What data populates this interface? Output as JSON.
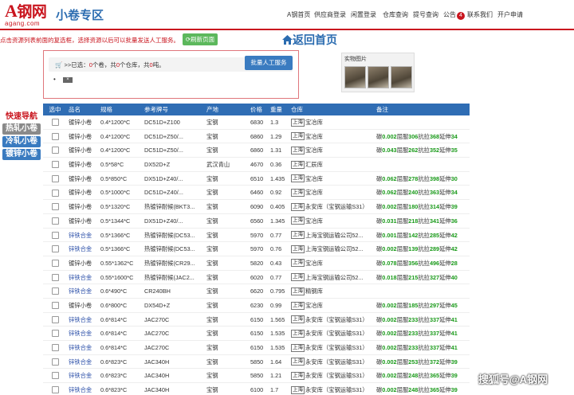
{
  "header": {
    "logo_main": "钢网",
    "logo_a": "A",
    "logo_sub": "agang.com",
    "site_title": "小卷专区",
    "nav": [
      "A钢首页",
      "供应商登录",
      "闲置登录",
      "仓库查询",
      "提号查询",
      "公告",
      "联系我们",
      "开户申请"
    ],
    "notice_count": "4"
  },
  "notice": {
    "text": "点击资源列表前面的复选框，选择资源以后可以批量发送人工服务。",
    "refresh_label": "刷新页面",
    "home_label": "返回首页"
  },
  "selection": {
    "prefix": ">>已选：",
    "rolls": "0",
    "rolls_unit": "个卷，共",
    "warehouses": "0",
    "wh_unit": "个仓库，共",
    "weight": "0",
    "weight_unit": "吨。",
    "batch_label": "批量人工服务",
    "remove_label": "×"
  },
  "photos": {
    "title": "实物图片"
  },
  "side_nav": {
    "title": "快速导航",
    "items": [
      "热轧小卷",
      "冷轧小卷",
      "镀锌小卷"
    ]
  },
  "table": {
    "headers": [
      "选中",
      "品名",
      "规格",
      "参考牌号",
      "产地",
      "价格",
      "重量",
      "仓库",
      "备注"
    ],
    "rows": [
      {
        "name": "镀锌小卷",
        "link": false,
        "spec": "0.4*1200*C",
        "grade": "DC51D+Z100",
        "origin": "宝钢",
        "price": "6830",
        "weight": "1.3",
        "city": "上海",
        "wh": "宝冶库",
        "n1": "",
        "n2": "",
        "n3": ""
      },
      {
        "name": "镀锌小卷",
        "link": false,
        "spec": "0.4*1200*C",
        "grade": "DC51D+Z50/...",
        "origin": "宝钢",
        "price": "6860",
        "weight": "1.29",
        "city": "上海",
        "wh": "宝冶库",
        "n1": "0.002",
        "n2": "306",
        "n3": "368",
        "n4": "34"
      },
      {
        "name": "镀锌小卷",
        "link": false,
        "spec": "0.4*1200*C",
        "grade": "DC51D+Z50/...",
        "origin": "宝钢",
        "price": "6860",
        "weight": "1.31",
        "city": "上海",
        "wh": "宝冶库",
        "n1": "0.043",
        "n2": "262",
        "n3": "352",
        "n4": "35"
      },
      {
        "name": "镀锌小卷",
        "link": false,
        "spec": "0.5*58*C",
        "grade": "DX52D+Z",
        "origin": "武汉青山",
        "price": "4670",
        "weight": "0.36",
        "city": "上海",
        "wh": "汇辰库",
        "n1": "",
        "n2": "",
        "n3": ""
      },
      {
        "name": "镀锌小卷",
        "link": false,
        "spec": "0.5*850*C",
        "grade": "DX51D+Z40/...",
        "origin": "宝钢",
        "price": "6510",
        "weight": "1.435",
        "city": "上海",
        "wh": "宝冶库",
        "n1": "0.062",
        "n2": "278",
        "n3": "398",
        "n4": "30"
      },
      {
        "name": "镀锌小卷",
        "link": false,
        "spec": "0.5*1000*C",
        "grade": "DC51D+Z40/...",
        "origin": "宝钢",
        "price": "6460",
        "weight": "0.92",
        "city": "上海",
        "wh": "宝冶库",
        "n1": "0.062",
        "n2": "240",
        "n3": "363",
        "n4": "34"
      },
      {
        "name": "镀锌小卷",
        "link": false,
        "spec": "0.5*1320*C",
        "grade": "热镀锌耐候(BKT3...",
        "origin": "宝钢",
        "price": "6090",
        "weight": "0.405",
        "city": "上海",
        "wh": "永安库（宝钢运输S31）",
        "n1": "0.002",
        "n2": "180",
        "n3": "314",
        "n4": "39"
      },
      {
        "name": "镀锌小卷",
        "link": false,
        "spec": "0.5*1344*C",
        "grade": "DX51D+Z40/...",
        "origin": "宝钢",
        "price": "6560",
        "weight": "1.345",
        "city": "上海",
        "wh": "宝冶库",
        "n1": "0.031",
        "n2": "218",
        "n3": "341",
        "n4": "36"
      },
      {
        "name": "锌铁合金",
        "link": true,
        "spec": "0.5*1366*C",
        "grade": "热镀锌耐候(DC53...",
        "origin": "宝钢",
        "price": "5970",
        "weight": "0.77",
        "city": "上海",
        "wh": "上海宝钢运输公司52...",
        "n1": "0.001",
        "n2": "142",
        "n3": "285",
        "n4": "42"
      },
      {
        "name": "锌铁合金",
        "link": true,
        "spec": "0.5*1366*C",
        "grade": "热镀锌耐候(DC53...",
        "origin": "宝钢",
        "price": "5970",
        "weight": "0.76",
        "city": "上海",
        "wh": "上海宝钢运输公司52...",
        "n1": "0.002",
        "n2": "139",
        "n3": "289",
        "n4": "42"
      },
      {
        "name": "镀锌小卷",
        "link": false,
        "spec": "0.55*1362*C",
        "grade": "热镀锌耐候(CR29...",
        "origin": "宝钢",
        "price": "5820",
        "weight": "0.43",
        "city": "上海",
        "wh": "宝冶库",
        "n1": "0.078",
        "n2": "356",
        "n3": "496",
        "n4": "28"
      },
      {
        "name": "锌铁合金",
        "link": true,
        "spec": "0.55*1600*C",
        "grade": "热镀锌耐候(JAC2...",
        "origin": "宝钢",
        "price": "6020",
        "weight": "0.77",
        "city": "上海",
        "wh": "上海宝钢运输公司52...",
        "n1": "0.018",
        "n2": "215",
        "n3": "327",
        "n4": "40"
      },
      {
        "name": "锌铁合金",
        "link": true,
        "spec": "0.6*490*C",
        "grade": "CR240BH",
        "origin": "宝钢",
        "price": "6620",
        "weight": "0.795",
        "city": "上海",
        "wh": "精钢库",
        "n1": "",
        "n2": "",
        "n3": ""
      },
      {
        "name": "镀锌小卷",
        "link": false,
        "spec": "0.6*800*C",
        "grade": "DX54D+Z",
        "origin": "宝钢",
        "price": "6230",
        "weight": "0.99",
        "city": "上海",
        "wh": "宝冶库",
        "n1": "0.002",
        "n2": "185",
        "n3": "297",
        "n4": "45"
      },
      {
        "name": "锌铁合金",
        "link": true,
        "spec": "0.6*814*C",
        "grade": "JAC270C",
        "origin": "宝钢",
        "price": "6150",
        "weight": "1.565",
        "city": "上海",
        "wh": "永安库（宝钢运输S31）",
        "n1": "0.002",
        "n2": "233",
        "n3": "337",
        "n4": "41"
      },
      {
        "name": "锌铁合金",
        "link": true,
        "spec": "0.6*814*C",
        "grade": "JAC270C",
        "origin": "宝钢",
        "price": "6150",
        "weight": "1.535",
        "city": "上海",
        "wh": "永安库（宝钢运输S31）",
        "n1": "0.002",
        "n2": "233",
        "n3": "337",
        "n4": "41"
      },
      {
        "name": "锌铁合金",
        "link": true,
        "spec": "0.6*814*C",
        "grade": "JAC270C",
        "origin": "宝钢",
        "price": "6150",
        "weight": "1.535",
        "city": "上海",
        "wh": "永安库（宝钢运输S31）",
        "n1": "0.002",
        "n2": "233",
        "n3": "337",
        "n4": "41"
      },
      {
        "name": "锌铁合金",
        "link": true,
        "spec": "0.6*823*C",
        "grade": "JAC340H",
        "origin": "宝钢",
        "price": "5850",
        "weight": "1.64",
        "city": "上海",
        "wh": "永安库（宝钢运输S31）",
        "n1": "0.002",
        "n2": "253",
        "n3": "372",
        "n4": "39"
      },
      {
        "name": "锌铁合金",
        "link": true,
        "spec": "0.6*823*C",
        "grade": "JAC340H",
        "origin": "宝钢",
        "price": "5850",
        "weight": "1.21",
        "city": "上海",
        "wh": "永安库（宝钢运输S31）",
        "n1": "0.002",
        "n2": "248",
        "n3": "365",
        "n4": "39"
      },
      {
        "name": "锌铁合金",
        "link": true,
        "spec": "0.6*823*C",
        "grade": "JAC340H",
        "origin": "宝钢",
        "price": "6100",
        "weight": "1.7",
        "city": "上海",
        "wh": "永安库（宝钢运输S31）",
        "n1": "0.002",
        "n2": "248",
        "n3": "365",
        "n4": "39"
      }
    ],
    "note_labels": {
      "prefix": "碳",
      "yield": "屈服",
      "tensile": "抗拉",
      "elong": "延伸"
    }
  },
  "watermark": "搜狐号@A钢网"
}
